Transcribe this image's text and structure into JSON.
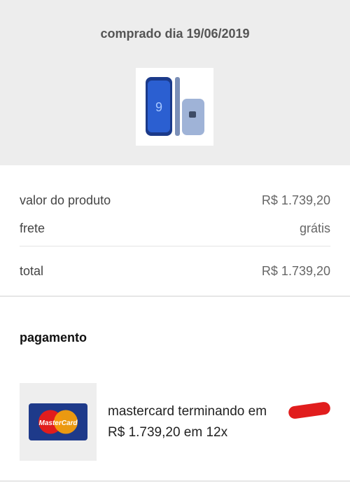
{
  "header": {
    "purchased_label": "comprado dia 19/06/2019"
  },
  "summary": {
    "product_label": "valor do produto",
    "product_value": "R$ 1.739,20",
    "shipping_label": "frete",
    "shipping_value": "grátis",
    "total_label": "total",
    "total_value": "R$ 1.739,20"
  },
  "payment": {
    "title": "pagamento",
    "card_line": "mastercard terminando em",
    "installments": "R$ 1.739,20 em 12x",
    "card_logo_text": "MasterCard",
    "card_colors": {
      "left": "#e11d1d",
      "right": "#f59e0b",
      "bg": "#1e3a8a"
    }
  }
}
